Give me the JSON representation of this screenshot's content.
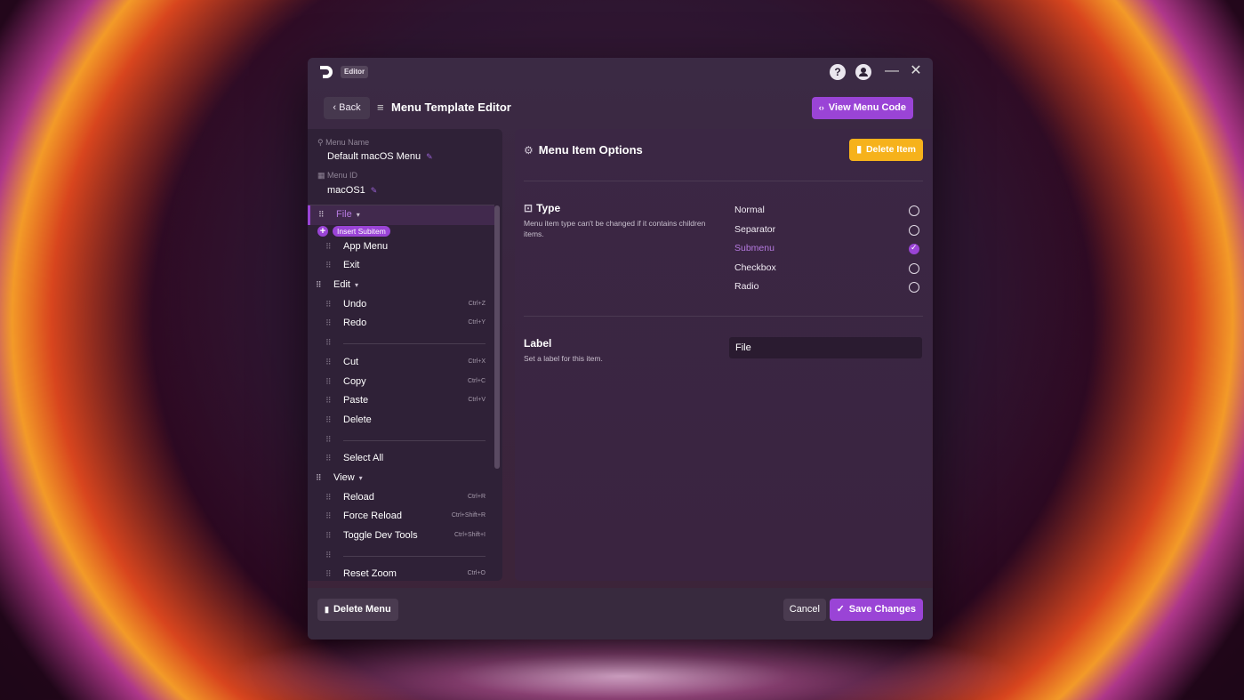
{
  "app": {
    "title_badge": "Editor",
    "help_glyph": "?",
    "minimize_glyph": "—",
    "close_glyph": "✕"
  },
  "header": {
    "back_label": "Back",
    "title": "Menu Template Editor",
    "view_code_label": "View Menu Code"
  },
  "menu_meta": {
    "name_label": "Menu Name",
    "name_value": "Default macOS Menu",
    "id_label": "Menu ID",
    "id_value": "macOS1"
  },
  "tree": {
    "insert_label": "Insert Subitem",
    "items": [
      {
        "label": "File",
        "level": 0,
        "selected": true,
        "caret": true
      },
      {
        "type": "insert"
      },
      {
        "label": "App Menu",
        "level": 1
      },
      {
        "label": "Exit",
        "level": 1
      },
      {
        "label": "Edit",
        "level": 0,
        "caret": true
      },
      {
        "label": "Undo",
        "level": 1,
        "shortcut": "Ctrl+Z"
      },
      {
        "label": "Redo",
        "level": 1,
        "shortcut": "Ctrl+Y"
      },
      {
        "type": "separator"
      },
      {
        "label": "Cut",
        "level": 1,
        "shortcut": "Ctrl+X"
      },
      {
        "label": "Copy",
        "level": 1,
        "shortcut": "Ctrl+C"
      },
      {
        "label": "Paste",
        "level": 1,
        "shortcut": "Ctrl+V"
      },
      {
        "label": "Delete",
        "level": 1
      },
      {
        "type": "separator"
      },
      {
        "label": "Select All",
        "level": 1
      },
      {
        "label": "View",
        "level": 0,
        "caret": true
      },
      {
        "label": "Reload",
        "level": 1,
        "shortcut": "Ctrl+R"
      },
      {
        "label": "Force Reload",
        "level": 1,
        "shortcut": "Ctrl+Shift+R"
      },
      {
        "label": "Toggle Dev Tools",
        "level": 1,
        "shortcut": "Ctrl+Shift+I"
      },
      {
        "type": "separator"
      },
      {
        "label": "Reset Zoom",
        "level": 1,
        "shortcut": "Ctrl+O"
      }
    ]
  },
  "options": {
    "title": "Menu Item Options",
    "delete_item_label": "Delete Item",
    "type_title": "Type",
    "type_desc": "Menu item type can't be changed if it contains children items.",
    "types": [
      {
        "label": "Normal",
        "checked": false
      },
      {
        "label": "Separator",
        "checked": false
      },
      {
        "label": "Submenu",
        "checked": true
      },
      {
        "label": "Checkbox",
        "checked": false
      },
      {
        "label": "Radio",
        "checked": false
      }
    ],
    "label_title": "Label",
    "label_desc": "Set a label for this item.",
    "label_value": "File"
  },
  "footer": {
    "delete_menu_label": "Delete Menu",
    "cancel_label": "Cancel",
    "save_label": "Save Changes"
  },
  "colors": {
    "accent": "#9a44d6",
    "warning": "#f6b21b"
  }
}
